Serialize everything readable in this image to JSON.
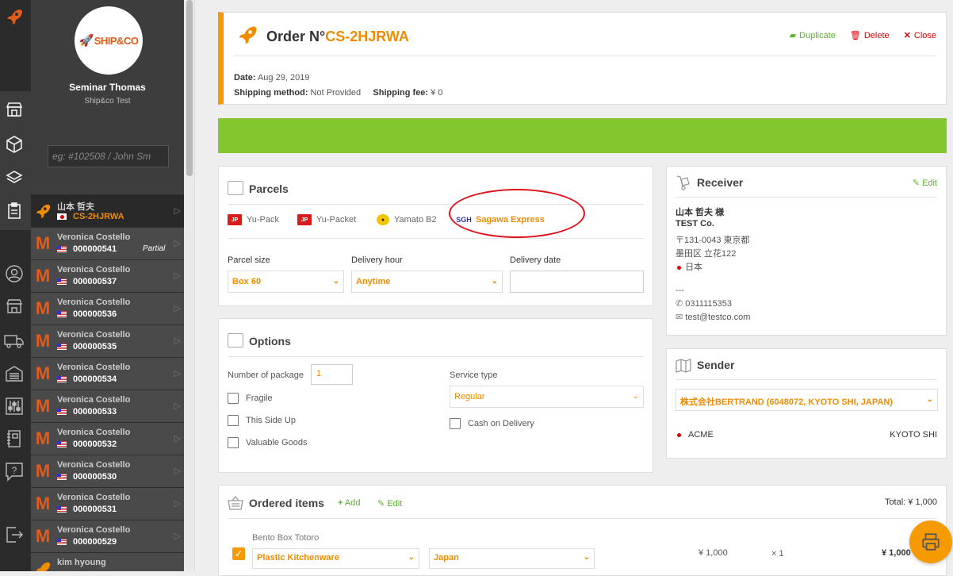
{
  "rail": {
    "icons": [
      "rocket-icon",
      "shop-icon",
      "box-icon",
      "layers-icon",
      "clipboard-icon",
      "user-circle-icon",
      "store-icon",
      "truck-icon",
      "warehouse-icon",
      "sliders-icon",
      "book-icon",
      "help-icon",
      "logout-icon"
    ]
  },
  "user": {
    "logo_text": "SHIP&CO",
    "name": "Seminar Thomas",
    "org": "Ship&co Test"
  },
  "search": {
    "placeholder": "eg: #102508 / John Sm"
  },
  "orders": [
    {
      "name": "山本 哲夫",
      "number": "CS-2HJRWA",
      "flag": "jp",
      "partial": "",
      "active": true
    },
    {
      "name": "Veronica Costello",
      "number": "000000541",
      "flag": "us",
      "partial": "Partial"
    },
    {
      "name": "Veronica Costello",
      "number": "000000537",
      "flag": "us",
      "partial": ""
    },
    {
      "name": "Veronica Costello",
      "number": "000000536",
      "flag": "us",
      "partial": ""
    },
    {
      "name": "Veronica Costello",
      "number": "000000535",
      "flag": "us",
      "partial": ""
    },
    {
      "name": "Veronica Costello",
      "number": "000000534",
      "flag": "us",
      "partial": ""
    },
    {
      "name": "Veronica Costello",
      "number": "000000533",
      "flag": "us",
      "partial": ""
    },
    {
      "name": "Veronica Costello",
      "number": "000000532",
      "flag": "us",
      "partial": ""
    },
    {
      "name": "Veronica Costello",
      "number": "000000530",
      "flag": "us",
      "partial": ""
    },
    {
      "name": "Veronica Costello",
      "number": "000000531",
      "flag": "us",
      "partial": ""
    },
    {
      "name": "Veronica Costello",
      "number": "000000529",
      "flag": "us",
      "partial": ""
    },
    {
      "name": "kim hyoung",
      "number": "",
      "flag": "",
      "partial": ""
    }
  ],
  "order": {
    "title_prefix": "Order N°",
    "code": "CS-2HJRWA",
    "duplicate": "Duplicate",
    "delete": "Delete",
    "close": "Close",
    "date_label": "Date:",
    "date": "Aug 29, 2019",
    "method_label": "Shipping method:",
    "method": "Not Provided",
    "fee_label": "Shipping fee:",
    "fee": "¥ 0"
  },
  "parcels": {
    "title": "Parcels",
    "carriers": [
      "Yu-Pack",
      "Yu-Packet",
      "Yamato B2",
      "Sagawa Express"
    ],
    "selected_carrier": "Sagawa Express",
    "size_label": "Parcel size",
    "size_value": "Box 60",
    "hour_label": "Delivery hour",
    "hour_value": "Anytime",
    "date_label": "Delivery date",
    "date_value": ""
  },
  "options": {
    "title": "Options",
    "num_label": "Number of package",
    "num_value": "1",
    "fragile": "Fragile",
    "this_side_up": "This Side Up",
    "valuable": "Valuable Goods",
    "service_label": "Service type",
    "service_value": "Regular",
    "cod": "Cash on Delivery"
  },
  "receiver": {
    "title": "Receiver",
    "edit": "Edit",
    "name": "山本 哲夫 様",
    "company": "TEST Co.",
    "postal": "〒131-0043 東京都",
    "address": "墨田区 立花122",
    "country": "日本",
    "sep": "---",
    "phone": "0311115353",
    "email": "test@testco.com"
  },
  "sender": {
    "title": "Sender",
    "select": "株式会社BERTRAND (6048072, KYOTO SHI, JAPAN)",
    "name": "ACME",
    "city": "KYOTO SHI"
  },
  "items": {
    "title": "Ordered items",
    "add": "Add",
    "edit": "Edit",
    "total": "Total: ¥ 1,000",
    "rows": [
      {
        "name": "Bento Box Totoro",
        "category": "Plastic Kitchenware",
        "origin": "Japan",
        "price": "¥ 1,000",
        "qty": "× 1",
        "subtotal": "¥ 1,000"
      }
    ]
  },
  "colors": {
    "accent": "#f08c00",
    "green": "#84c630",
    "danger": "#dd0000",
    "sidebar": "#3d3d3d"
  }
}
